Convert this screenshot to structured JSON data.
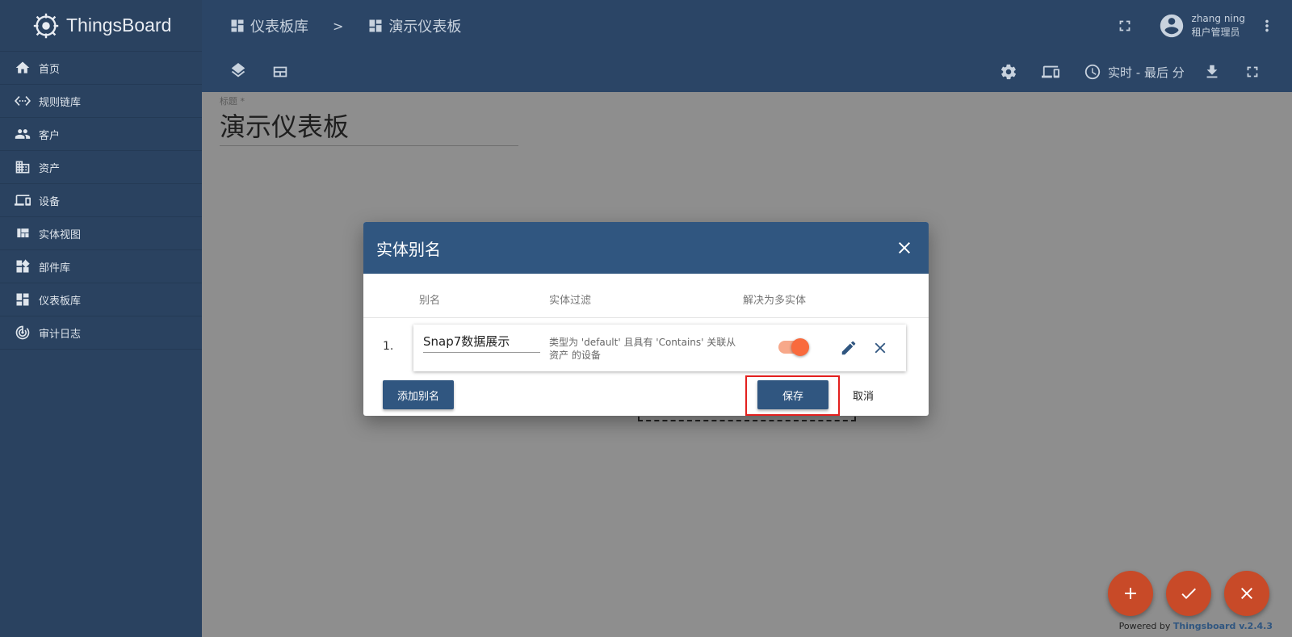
{
  "app": {
    "brand": "ThingsBoard"
  },
  "sidebar": {
    "items": [
      {
        "label": "首页",
        "icon": "home-icon"
      },
      {
        "label": "规则链库",
        "icon": "settings-ethernet-icon"
      },
      {
        "label": "客户",
        "icon": "people-icon"
      },
      {
        "label": "资产",
        "icon": "domain-icon"
      },
      {
        "label": "设备",
        "icon": "devices-icon"
      },
      {
        "label": "实体视图",
        "icon": "view-quilt-icon"
      },
      {
        "label": "部件库",
        "icon": "widgets-icon"
      },
      {
        "label": "仪表板库",
        "icon": "dashboards-icon"
      },
      {
        "label": "审计日志",
        "icon": "track-changes-icon"
      }
    ]
  },
  "header": {
    "breadcrumb": [
      {
        "label": "仪表板库"
      },
      {
        "label": "演示仪表板"
      }
    ],
    "separator": ">",
    "user": {
      "name": "zhang ning",
      "role": "租户管理员"
    }
  },
  "toolbar": {
    "time_window": "实时 - 最后 分"
  },
  "dashboard": {
    "title_label": "标题 *",
    "title_value": "演示仪表板"
  },
  "dialog": {
    "title": "实体别名",
    "columns": {
      "alias": "别名",
      "filter": "实体过滤",
      "multi": "解决为多实体"
    },
    "rows": [
      {
        "index": "1.",
        "alias": "Snap7数据展示",
        "filter": "类型为 'default' 且具有 'Contains' 关联从 资产 的设备",
        "resolve_multiple": true
      }
    ],
    "add_button": "添加别名",
    "save_button": "保存",
    "cancel_button": "取消"
  },
  "footer": {
    "powered_prefix": "Powered by",
    "powered_brand": "Thingsboard v.2.4.3"
  },
  "colors": {
    "sidebar": "#2a4260",
    "header": "#2b4566",
    "primary": "#305680",
    "accent": "#f96a3d",
    "fab": "#c84a28",
    "highlight": "#e3201e"
  }
}
